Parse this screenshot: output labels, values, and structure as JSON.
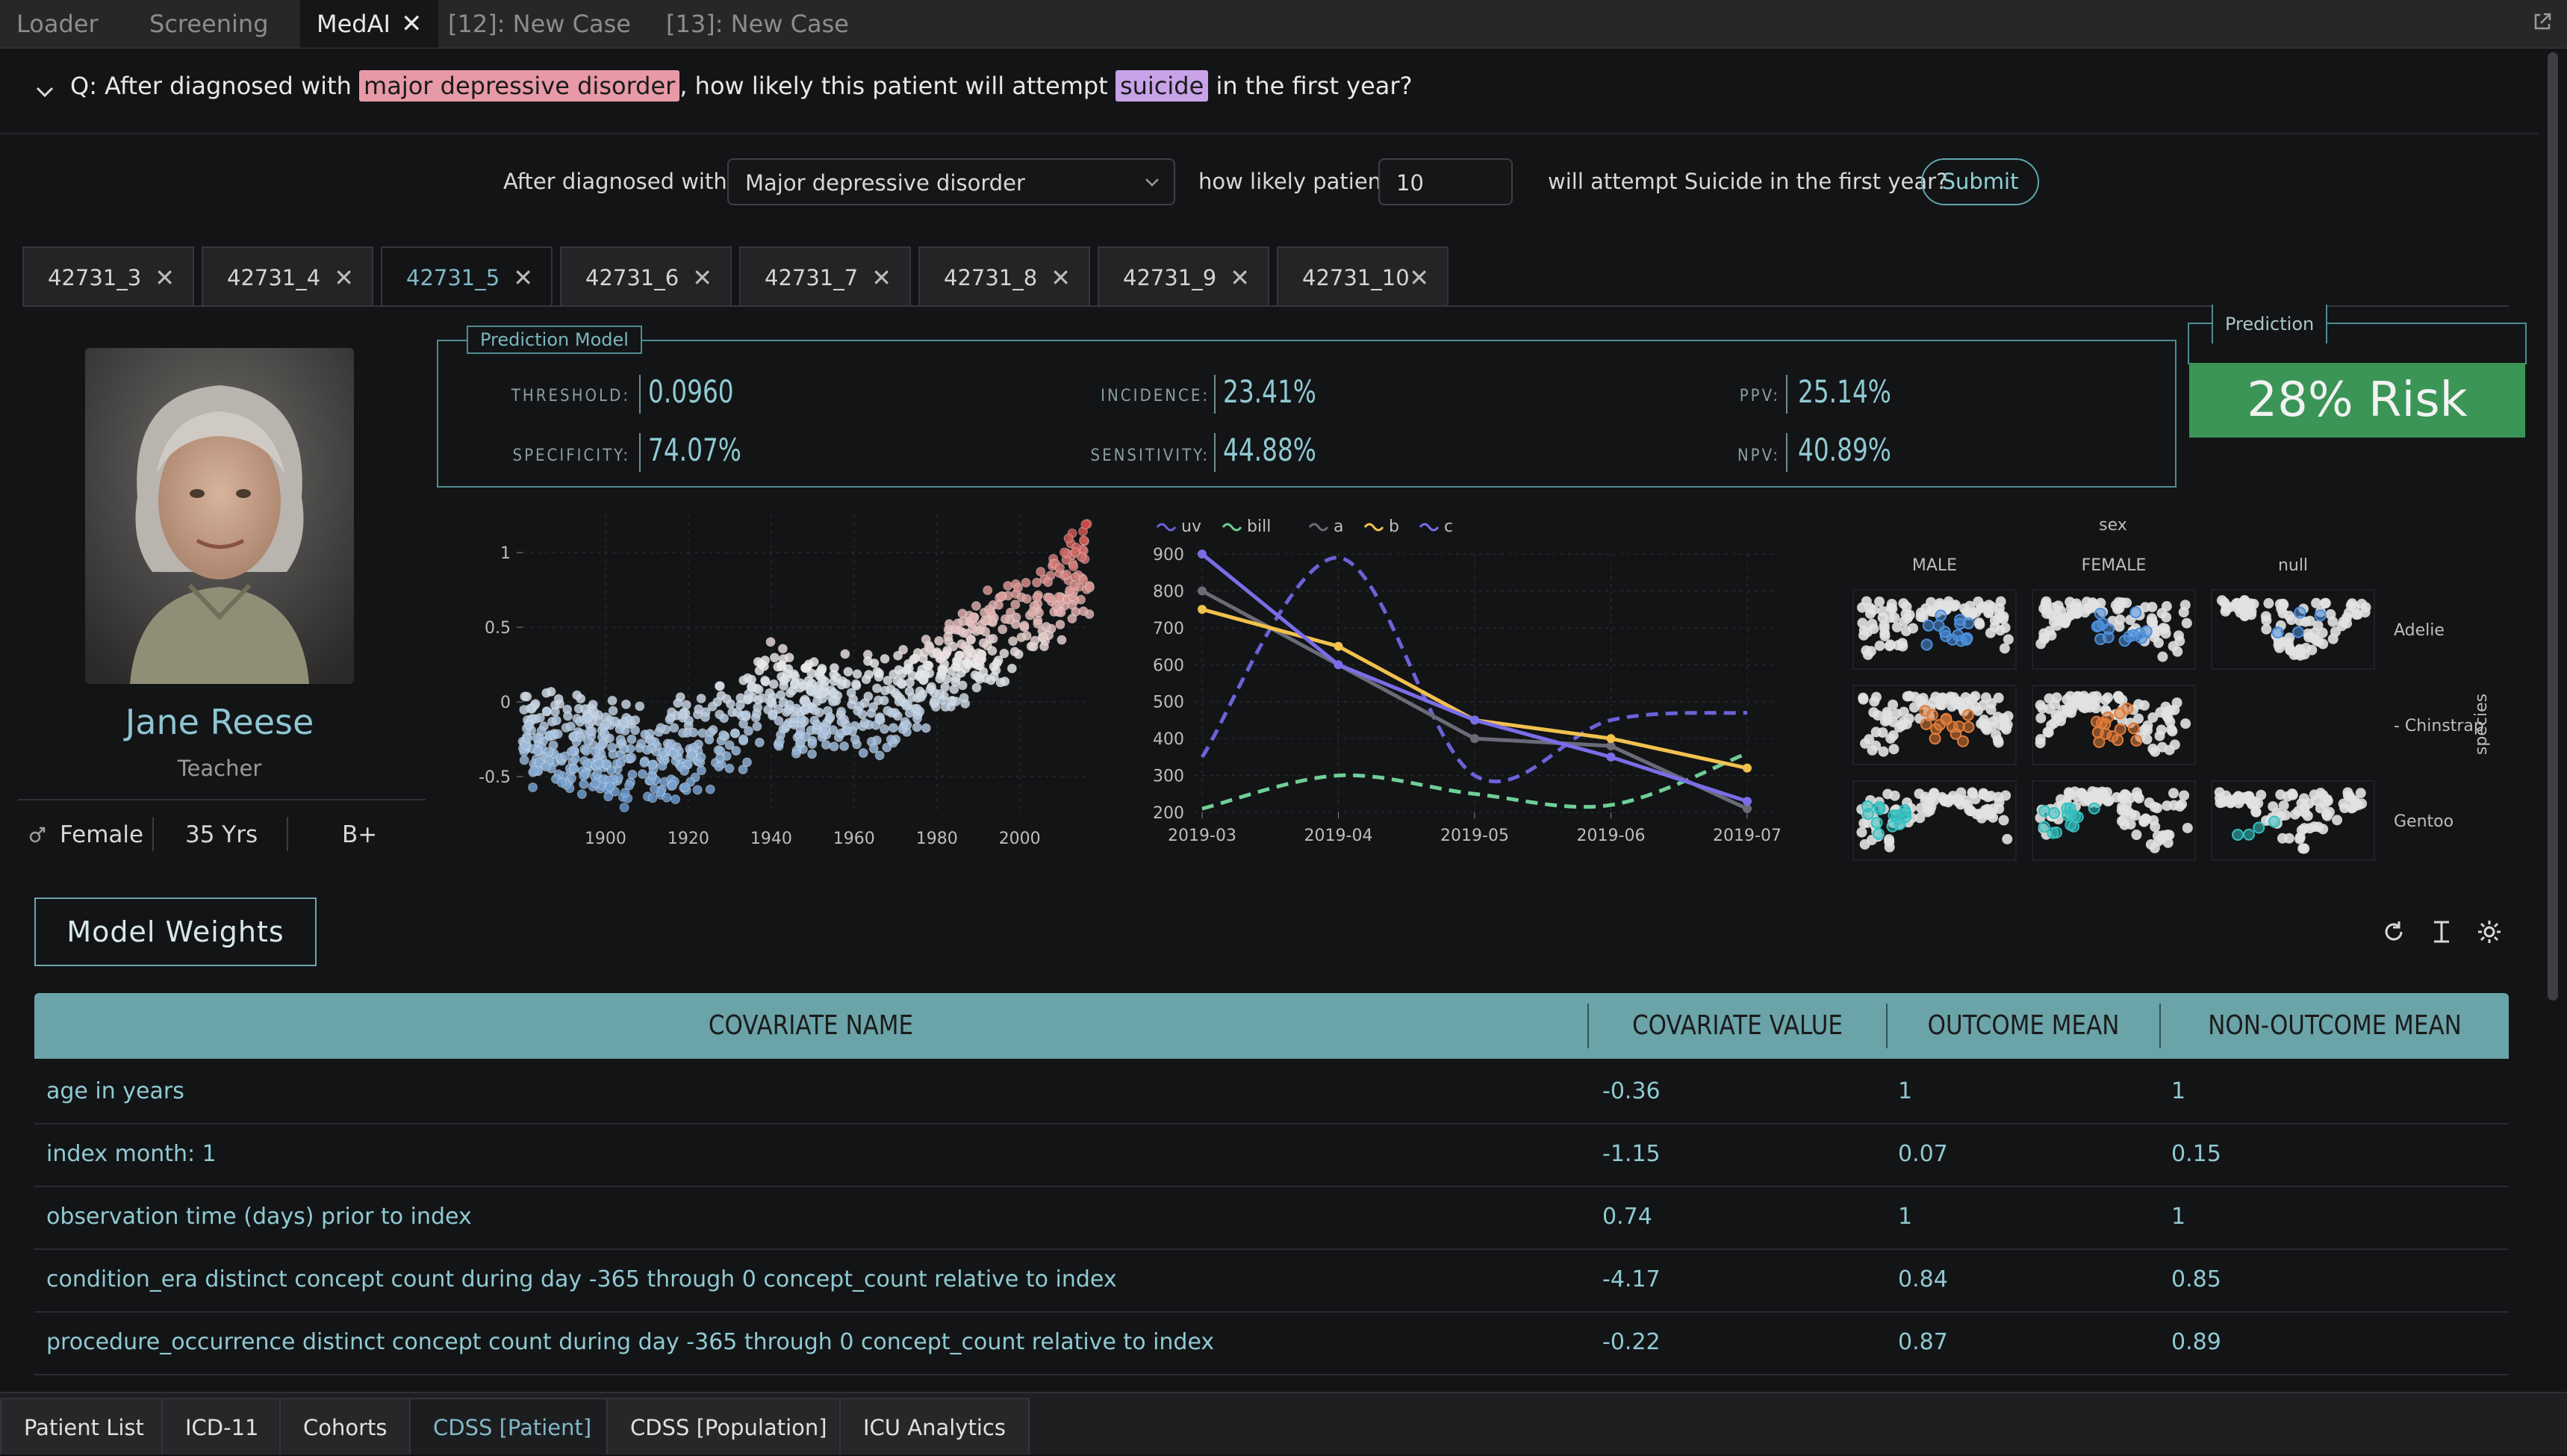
{
  "top_tabs": [
    {
      "label": "Loader"
    },
    {
      "label": "Screening"
    },
    {
      "label": "MedAI"
    },
    {
      "label": "[12]: New Case"
    },
    {
      "label": "[13]: New Case"
    }
  ],
  "question": {
    "prefix": "Q: After diagnosed with",
    "condition": "major depressive disorder",
    "middle": ", how likely this patient will attempt",
    "outcome": "suicide",
    "suffix": "in the first year?"
  },
  "form": {
    "label1": "After diagnosed with",
    "diagnosis_value": "Major depressive disorder",
    "label2": "how likely patient",
    "patient_value": "10",
    "label3": "will attempt Suicide in the first year?",
    "submit_label": "Submit"
  },
  "case_tabs": [
    "42731_3",
    "42731_4",
    "42731_5",
    "42731_6",
    "42731_7",
    "42731_8",
    "42731_9",
    "42731_10"
  ],
  "active_case_tab": "42731_5",
  "patient": {
    "name": "Jane Reese",
    "occupation": "Teacher",
    "sex": "Female",
    "age": "35 Yrs",
    "blood_type": "B+"
  },
  "prediction_model": {
    "label": "Prediction Model",
    "threshold_key": "THRESHOLD:",
    "threshold": "0.0960",
    "incidence_key": "INCIDENCE:",
    "incidence": "23.41%",
    "ppv_key": "PPV:",
    "ppv": "25.14%",
    "specificity_key": "SPECIFICITY:",
    "specificity": "74.07%",
    "sensitivity_key": "SENSITIVITY:",
    "sensitivity": "44.88%",
    "npv_key": "NPV:",
    "npv": "40.89%"
  },
  "prediction": {
    "label": "Prediction",
    "risk": "28% Risk",
    "color": "#3a9556"
  },
  "chart_data": [
    {
      "type": "scatter",
      "title": "",
      "x_ticks": [
        "1900",
        "1920",
        "1940",
        "1960",
        "1980",
        "2000"
      ],
      "y_ticks": [
        "1",
        "0.5",
        "0",
        "-0.5"
      ],
      "xlim": [
        1880,
        2017
      ],
      "ylim": [
        -0.75,
        1.25
      ],
      "trend": [
        [
          1880,
          -0.25
        ],
        [
          1900,
          -0.3
        ],
        [
          1910,
          -0.38
        ],
        [
          1920,
          -0.28
        ],
        [
          1930,
          -0.2
        ],
        [
          1940,
          0.05
        ],
        [
          1950,
          -0.05
        ],
        [
          1960,
          0.0
        ],
        [
          1970,
          -0.02
        ],
        [
          1980,
          0.2
        ],
        [
          1990,
          0.38
        ],
        [
          2000,
          0.55
        ],
        [
          2010,
          0.72
        ],
        [
          2016,
          0.95
        ]
      ],
      "color_low": "#5b8fc9",
      "color_high": "#c8403a"
    },
    {
      "type": "line",
      "legend": [
        "uv",
        "bill",
        "a",
        "b",
        "c"
      ],
      "categories": [
        "2019-03",
        "2019-04",
        "2019-05",
        "2019-06",
        "2019-07"
      ],
      "y_ticks": [
        "900",
        "800",
        "700",
        "600",
        "500",
        "400",
        "300",
        "200"
      ],
      "ylim": [
        200,
        900
      ],
      "series": [
        {
          "name": "uv",
          "color": "#6a63d8",
          "style": "dashed",
          "values": [
            350,
            890,
            300,
            450,
            470
          ]
        },
        {
          "name": "bill",
          "color": "#6fcf97",
          "style": "dashed",
          "values": [
            210,
            300,
            250,
            220,
            360
          ]
        },
        {
          "name": "a",
          "color": "#6b6b78",
          "style": "solid",
          "values": [
            800,
            600,
            400,
            380,
            210
          ]
        },
        {
          "name": "b",
          "color": "#f2c14e",
          "style": "solid",
          "values": [
            750,
            650,
            450,
            400,
            320
          ]
        },
        {
          "name": "c",
          "color": "#7a6ee8",
          "style": "solid",
          "values": [
            900,
            600,
            450,
            350,
            230
          ]
        }
      ]
    },
    {
      "type": "scatter",
      "title": "sex",
      "columns": [
        "MALE",
        "FEMALE",
        "null"
      ],
      "rows": [
        "Adelie",
        "Chinstrap",
        "Gentoo"
      ],
      "facet_label": "species",
      "row_colors": [
        "#4d8fdc",
        "#e07b39",
        "#35c0c0"
      ]
    }
  ],
  "model_weights": {
    "button_label": "Model Weights",
    "columns": [
      "COVARIATE NAME",
      "COVARIATE VALUE",
      "OUTCOME MEAN",
      "NON-OUTCOME MEAN"
    ],
    "rows": [
      {
        "name": "age in years",
        "value": "-0.36",
        "outcome": "1",
        "non_outcome": "1"
      },
      {
        "name": "index month: 1",
        "value": "-1.15",
        "outcome": "0.07",
        "non_outcome": "0.15"
      },
      {
        "name": "observation time (days) prior to index",
        "value": "0.74",
        "outcome": "1",
        "non_outcome": "1"
      },
      {
        "name": "condition_era distinct concept count during day -365 through 0 concept_count relative to index",
        "value": "-4.17",
        "outcome": "0.84",
        "non_outcome": "0.85"
      },
      {
        "name": "procedure_occurrence distinct concept count during day -365 through 0 concept_count relative to index",
        "value": "-0.22",
        "outcome": "0.87",
        "non_outcome": "0.89"
      }
    ]
  },
  "bottom_tabs": [
    "Patient List",
    "ICD-11",
    "Cohorts",
    "CDSS [Patient]",
    "CDSS [Population]",
    "ICU Analytics"
  ],
  "active_bottom_tab": "CDSS [Patient]",
  "accent_color": "#6aa3a8"
}
